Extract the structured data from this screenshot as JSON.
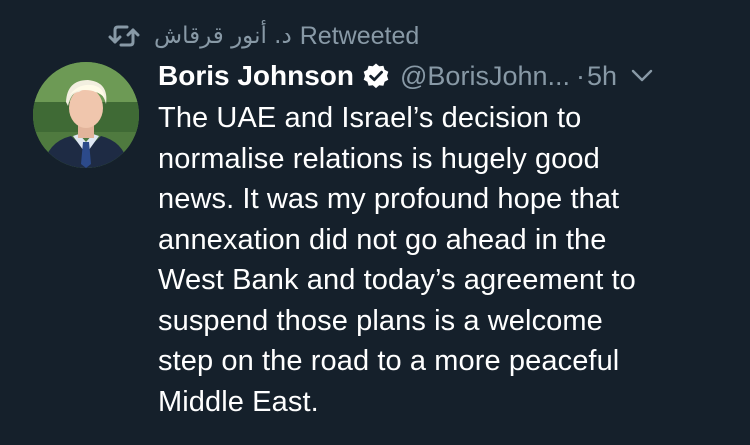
{
  "retweet": {
    "icon": "retweet-icon",
    "retweeter_name": "د. أنور قرقاش",
    "label": "Retweeted"
  },
  "tweet": {
    "author_name": "Boris Johnson",
    "verified_icon": "verified-badge-icon",
    "handle": "@BorisJohn...",
    "separator": "·",
    "time": "5h",
    "menu_icon": "chevron-down-icon",
    "text_lines": [
      "The UAE and Israel’s decision to",
      "normalise relations is hugely good",
      "news. It was my profound hope that",
      "annexation did not go ahead in the",
      "West Bank and today’s agreement to",
      "suspend those plans is a welcome",
      "step on the road to a more peaceful",
      "Middle East."
    ]
  },
  "colors": {
    "background": "#15202b",
    "text_primary": "#ffffff",
    "text_secondary": "#8899a6"
  }
}
